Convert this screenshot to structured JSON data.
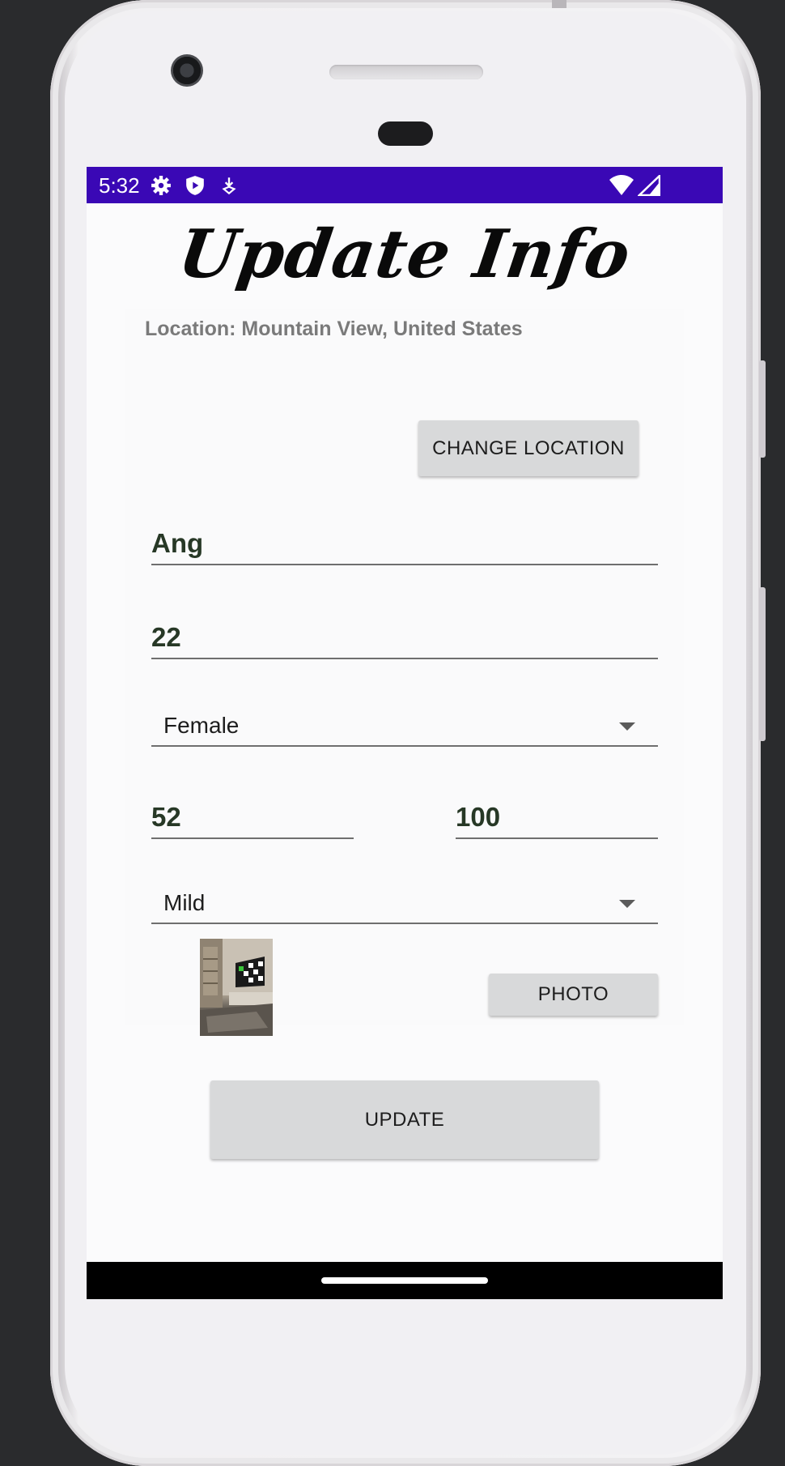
{
  "status_bar": {
    "time": "5:32",
    "icons_left": [
      "gear-icon",
      "shield-icon",
      "download-icon"
    ],
    "icons_right": [
      "wifi-icon",
      "signal-icon"
    ],
    "color": "#3a08b5"
  },
  "title": "Update Info",
  "location_text": "Location: Mountain View, United States",
  "buttons": {
    "change_location": "CHANGE LOCATION",
    "photo": "PHOTO",
    "update": "UPDATE"
  },
  "fields": {
    "name": "Ang",
    "age": "22",
    "gender": "Female",
    "value_left": "52",
    "value_right": "100",
    "severity": "Mild"
  },
  "colors": {
    "field_text": "#273826",
    "button_bg": "#d8d9da",
    "screen_bg": "#fbfbfc"
  }
}
